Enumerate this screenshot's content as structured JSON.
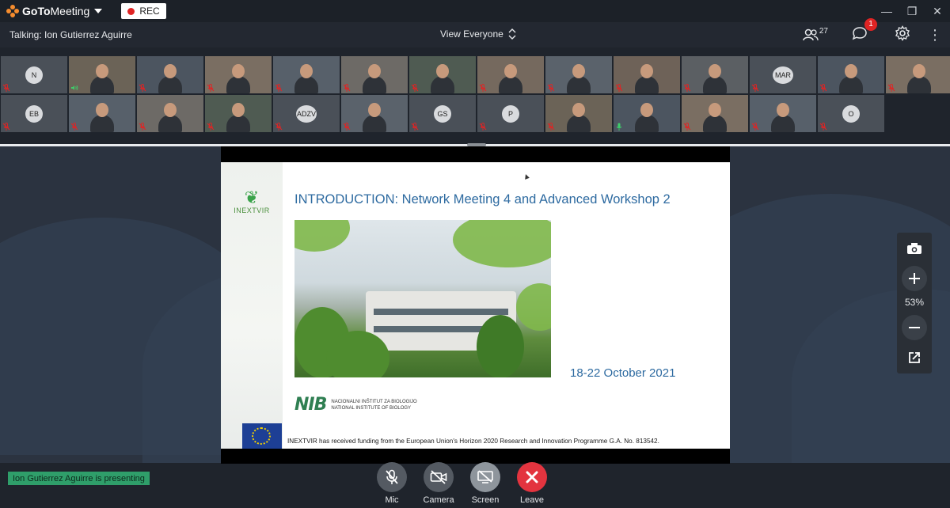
{
  "app": {
    "name_bold": "GoTo",
    "name_thin": "Meeting",
    "rec_label": "REC"
  },
  "infobar": {
    "talking": "Talking: Ion Gutierrez Aguirre",
    "view_label": "View Everyone",
    "participants_count": "27",
    "chat_badge": "1"
  },
  "participants": {
    "row1": [
      {
        "initials": "N",
        "muted": true
      },
      {
        "initials": "",
        "muted": false,
        "speaking": true
      },
      {
        "initials": "",
        "muted": true
      },
      {
        "initials": "",
        "muted": true
      },
      {
        "initials": "",
        "muted": true
      },
      {
        "initials": "",
        "muted": true
      },
      {
        "initials": "",
        "muted": true
      },
      {
        "initials": "",
        "muted": true
      },
      {
        "initials": "",
        "muted": true
      },
      {
        "initials": "",
        "muted": true
      },
      {
        "initials": "",
        "muted": true
      },
      {
        "initials": "MAR",
        "muted": true
      },
      {
        "initials": "",
        "muted": true
      },
      {
        "initials": "",
        "muted": true
      }
    ],
    "row2": [
      {
        "initials": "EB",
        "muted": true
      },
      {
        "initials": "",
        "muted": true
      },
      {
        "initials": "",
        "muted": true
      },
      {
        "initials": "",
        "muted": true
      },
      {
        "initials": "ADZV",
        "muted": true
      },
      {
        "initials": "",
        "muted": true
      },
      {
        "initials": "GS",
        "muted": true
      },
      {
        "initials": "P",
        "muted": true
      },
      {
        "initials": "",
        "muted": true
      },
      {
        "initials": "",
        "muted": false,
        "mic_on": true
      },
      {
        "initials": "",
        "muted": true
      },
      {
        "initials": "",
        "muted": true
      },
      {
        "initials": "O",
        "muted": true
      }
    ]
  },
  "slide": {
    "logo_text": "INEXTVIR",
    "title": "INTRODUCTION: Network Meeting 4 and Advanced Workshop 2",
    "date": "18-22 October 2021",
    "nib_mark": "NIB",
    "nib_line1": "NACIONALNI INŠTITUT ZA BIOLOGIJO",
    "nib_line2": "NATIONAL INSTITUTE OF BIOLOGY",
    "funding": "INEXTVIR has received funding from the European Union's Horizon 2020 Research and Innovation Programme G.A. No. 813542."
  },
  "zoom": {
    "percent": "53%"
  },
  "status": {
    "presenting": "Ion Gutierrez Aguirre is presenting"
  },
  "controls": {
    "mic": "Mic",
    "camera": "Camera",
    "screen": "Screen",
    "leave": "Leave"
  },
  "colors": {
    "accent_green": "#2f9e6a",
    "leave_red": "#e3343f",
    "muted_red": "#e02424",
    "slide_blue": "#2d6aa0"
  }
}
